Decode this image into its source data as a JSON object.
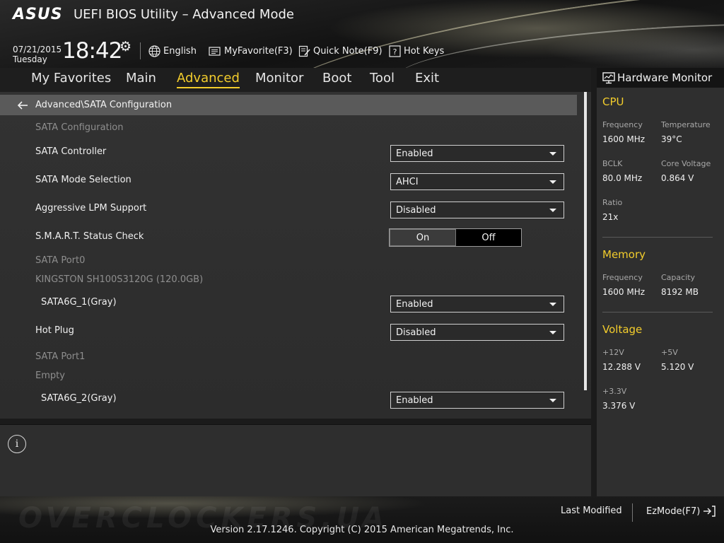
{
  "header": {
    "logo": "ASUS",
    "title": "UEFI BIOS Utility – Advanced Mode",
    "date": "07/21/2015",
    "day": "Tuesday",
    "time": "18:42",
    "tools": {
      "language": "English",
      "myfavorite": "MyFavorite(F3)",
      "quicknote": "Quick Note(F9)",
      "hotkeys": "Hot Keys"
    }
  },
  "nav": {
    "items": [
      "My Favorites",
      "Main",
      "Advanced",
      "Monitor",
      "Boot",
      "Tool",
      "Exit"
    ],
    "active": "Advanced"
  },
  "breadcrumb": "Advanced\\SATA Configuration",
  "settings": {
    "section_sata": "SATA Configuration",
    "sata_controller": {
      "label": "SATA Controller",
      "value": "Enabled"
    },
    "sata_mode": {
      "label": "SATA Mode Selection",
      "value": "AHCI"
    },
    "lpm": {
      "label": "Aggressive LPM Support",
      "value": "Disabled"
    },
    "smart": {
      "label": "S.M.A.R.T. Status Check",
      "on": "On",
      "off": "Off",
      "selected": "On"
    },
    "port0_title": "SATA Port0",
    "port0_device": "KINGSTON SH100S3120G (120.0GB)",
    "sata6g_1": {
      "label": "SATA6G_1(Gray)",
      "value": "Enabled"
    },
    "hot_plug": {
      "label": "Hot Plug",
      "value": "Disabled"
    },
    "port1_title": "SATA Port1",
    "port1_device": "Empty",
    "sata6g_2": {
      "label": "SATA6G_2(Gray)",
      "value": "Enabled"
    }
  },
  "hwmon": {
    "title": "Hardware Monitor",
    "cpu": {
      "title": "CPU",
      "frequency_label": "Frequency",
      "frequency": "1600 MHz",
      "temperature_label": "Temperature",
      "temperature": "39°C",
      "bclk_label": "BCLK",
      "bclk": "80.0 MHz",
      "core_voltage_label": "Core Voltage",
      "core_voltage": "0.864 V",
      "ratio_label": "Ratio",
      "ratio": "21x"
    },
    "memory": {
      "title": "Memory",
      "frequency_label": "Frequency",
      "frequency": "1600 MHz",
      "capacity_label": "Capacity",
      "capacity": "8192 MB"
    },
    "voltage": {
      "title": "Voltage",
      "v12_label": "+12V",
      "v12": "12.288 V",
      "v5_label": "+5V",
      "v5": "5.120 V",
      "v33_label": "+3.3V",
      "v33": "3.376 V"
    }
  },
  "footer": {
    "last_modified": "Last Modified",
    "ezmode": "EzMode(F7)",
    "copyright": "Version 2.17.1246. Copyright (C) 2015 American Megatrends, Inc.",
    "watermark": "OVERCLOCKERS.UA"
  },
  "colors": {
    "accent": "#f3cd2c",
    "panel": "#2f2f2f",
    "breadcrumb": "#5a5a5a"
  }
}
